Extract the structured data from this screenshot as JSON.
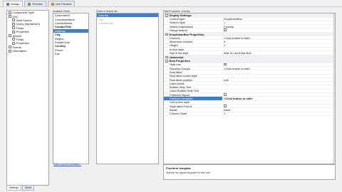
{
  "tabs": [
    {
      "label": "Design",
      "color": "#4a7cc8",
      "active": true
    },
    {
      "label": "Preview",
      "color": "#6aa04a",
      "active": false
    },
    {
      "label": "Live Preview",
      "color": "#c8843a",
      "active": false
    }
  ],
  "tree": {
    "items": [
      {
        "label": "Component Type",
        "indent": 0
      },
      {
        "label": "DSC",
        "indent": 0
      },
      {
        "label": "Data Source",
        "indent": 1
      },
      {
        "label": "Query (AlphaDAO)",
        "indent": 1
      },
      {
        "label": "Fields",
        "indent": 1
      },
      {
        "label": "Properties",
        "indent": 1
      },
      {
        "label": "Search",
        "indent": 0
      },
      {
        "label": "Fields",
        "indent": 1
      },
      {
        "label": "Properties",
        "indent": 1
      },
      {
        "label": "Events",
        "indent": 0
      },
      {
        "label": "Information",
        "indent": 0
      }
    ]
  },
  "available_fields": {
    "label": "Available Fields:",
    "items": [
      {
        "label": "CustomerID",
        "bold": false,
        "selected": false
      },
      {
        "label": "CompanyName",
        "bold": false,
        "selected": false
      },
      {
        "label": "ContactName",
        "bold": false,
        "selected": false
      },
      {
        "label": "ContactTitle",
        "bold": true,
        "selected": false
      },
      {
        "label": "Address",
        "bold": false,
        "selected": true
      },
      {
        "label": "City",
        "bold": true,
        "selected": false
      },
      {
        "label": "Region",
        "bold": false,
        "selected": false
      },
      {
        "label": "PostalCode",
        "bold": false,
        "selected": false
      },
      {
        "label": "Country",
        "bold": true,
        "selected": false
      },
      {
        "label": "Phone",
        "bold": false,
        "selected": false
      },
      {
        "label": "Fax",
        "bold": false,
        "selected": false
      }
    ]
  },
  "search_fields": {
    "label": "Fields in Search list:",
    "items": [
      {
        "label": "Country",
        "selected": true
      },
      {
        "label": "City",
        "selected": false
      },
      {
        "label": "ContactTitle",
        "selected": false
      }
    ]
  },
  "field_properties": {
    "label": "Field Properties: Country",
    "groups": [
      {
        "title": "Display Settings",
        "rows": [
          {
            "name": "Control type",
            "value": "DropDownBox"
          },
          {
            "name": "Search style",
            "value": "="
          },
          {
            "name": "Search expression",
            "value": "Country"
          },
          {
            "name": "Range search",
            "value": "",
            "checkbox": true
          }
        ]
      },
      {
        "title": "DropDownBox Properties",
        "rows": [
          {
            "name": "Choices",
            "value": "<Click button to edit>"
          },
          {
            "name": "Maximum choices",
            "value": "0"
          },
          {
            "name": "Height",
            "value": "1"
          },
          {
            "name": "In-line style",
            "value": ""
          },
          {
            "name": "Null in list style",
            "value": "Add To List If Not Null"
          }
        ]
      },
      {
        "title": "Javascript",
        "rows": []
      },
      {
        "title": "Row Properties",
        "rows": [
          {
            "name": "Hide row",
            "value": "",
            "checkbox": true
          },
          {
            "name": "Security Groups",
            "value": "<Click button to edit>"
          },
          {
            "name": "Row label",
            "value": ""
          },
          {
            "name": "Row label in-line style",
            "value": ""
          },
          {
            "name": "Row label position",
            "value": "Left"
          },
          {
            "name": "Label prefix",
            "value": ""
          },
          {
            "name": "Bubble Help Text",
            "value": ""
          },
          {
            "name": "Label Bubble Help Text",
            "value": ""
          },
          {
            "name": "Freeform layout",
            "value": "",
            "checkbox": true
          },
          {
            "name": "Freeform template",
            "value": "<Click button to edit>",
            "selected": true
          },
          {
            "name": "Cell in-line style",
            "value": ""
          },
          {
            "name": "Style label if error",
            "value": "",
            "checkbox": true
          },
          {
            "name": "Break",
            "value": "None"
          },
          {
            "name": "Column Span",
            "value": "1"
          }
        ]
      }
    ]
  },
  "description": {
    "title": "Freeform template",
    "text": "Specify the layout template for this row."
  },
  "insert_link": "Insert Layout Command...",
  "bottom_tabs": [
    {
      "label": "Settings",
      "active": true
    },
    {
      "label": "Sheet",
      "active": false
    }
  ]
}
